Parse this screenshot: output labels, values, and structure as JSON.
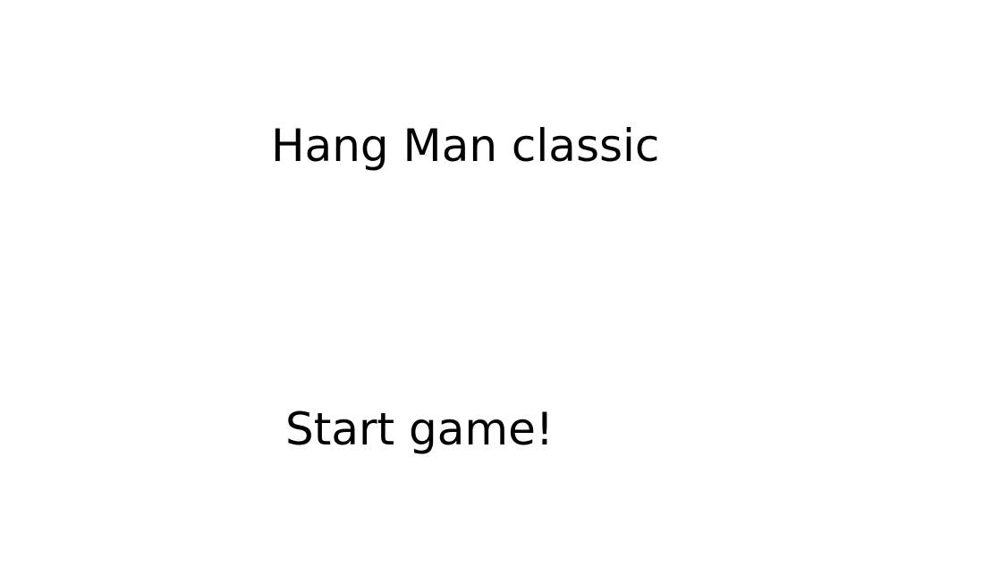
{
  "start_screen": {
    "title": "Hang Man classic",
    "start_label": "Start game!"
  },
  "colors": {
    "background": "#ffffff",
    "text": "#000000"
  }
}
